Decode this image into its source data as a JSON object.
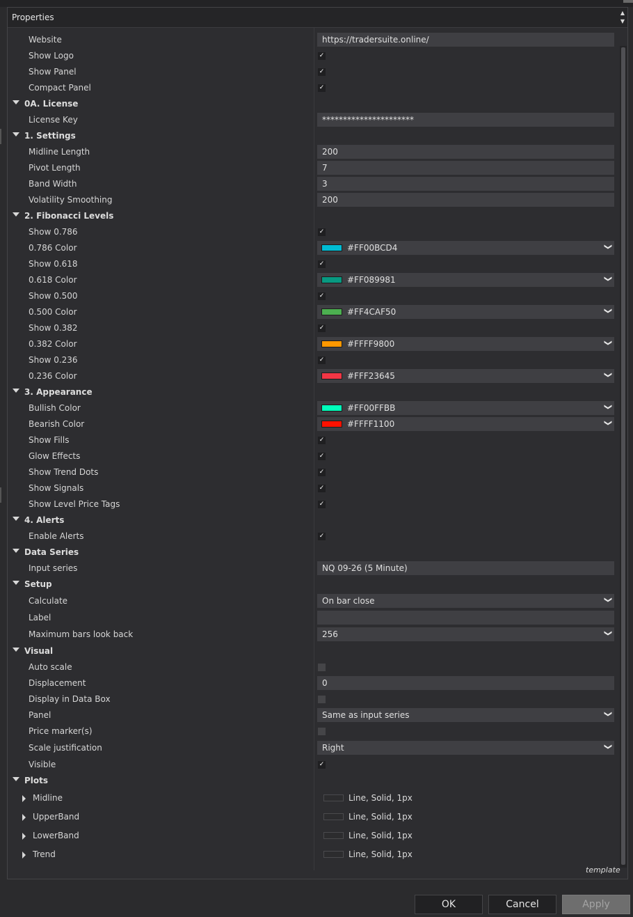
{
  "header": {
    "title": "Properties"
  },
  "rows": [
    {
      "type": "prop",
      "label": "Website",
      "value": "https://tradersuite.online/",
      "kind": "text"
    },
    {
      "type": "prop",
      "label": "Show Logo",
      "kind": "check",
      "checked": true
    },
    {
      "type": "prop",
      "label": "Show Panel",
      "kind": "check",
      "checked": true
    },
    {
      "type": "prop",
      "label": "Compact Panel",
      "kind": "check",
      "checked": true
    },
    {
      "type": "cat",
      "label": "0A. License"
    },
    {
      "type": "prop",
      "label": "License Key",
      "value": "**********************",
      "kind": "text"
    },
    {
      "type": "cat",
      "label": "1. Settings"
    },
    {
      "type": "prop",
      "label": "Midline Length",
      "value": "200",
      "kind": "text"
    },
    {
      "type": "prop",
      "label": "Pivot Length",
      "value": "7",
      "kind": "text"
    },
    {
      "type": "prop",
      "label": "Band Width",
      "value": "3",
      "kind": "text"
    },
    {
      "type": "prop",
      "label": "Volatility Smoothing",
      "value": "200",
      "kind": "text"
    },
    {
      "type": "cat",
      "label": "2. Fibonacci Levels"
    },
    {
      "type": "prop",
      "label": "Show 0.786",
      "kind": "check",
      "checked": true
    },
    {
      "type": "prop",
      "label": "0.786 Color",
      "kind": "color",
      "value": "#FF00BCD4",
      "color": "#00BCD4"
    },
    {
      "type": "prop",
      "label": "Show 0.618",
      "kind": "check",
      "checked": true
    },
    {
      "type": "prop",
      "label": "0.618 Color",
      "kind": "color",
      "value": "#FF089981",
      "color": "#089981"
    },
    {
      "type": "prop",
      "label": "Show 0.500",
      "kind": "check",
      "checked": true
    },
    {
      "type": "prop",
      "label": "0.500 Color",
      "kind": "color",
      "value": "#FF4CAF50",
      "color": "#4CAF50"
    },
    {
      "type": "prop",
      "label": "Show 0.382",
      "kind": "check",
      "checked": true
    },
    {
      "type": "prop",
      "label": "0.382 Color",
      "kind": "color",
      "value": "#FFFF9800",
      "color": "#FF9800"
    },
    {
      "type": "prop",
      "label": "Show 0.236",
      "kind": "check",
      "checked": true
    },
    {
      "type": "prop",
      "label": "0.236 Color",
      "kind": "color",
      "value": "#FFF23645",
      "color": "#F23645"
    },
    {
      "type": "cat",
      "label": "3. Appearance"
    },
    {
      "type": "prop",
      "label": "Bullish Color",
      "kind": "color",
      "value": "#FF00FFBB",
      "color": "#00FFBB"
    },
    {
      "type": "prop",
      "label": "Bearish Color",
      "kind": "color",
      "value": "#FFFF1100",
      "color": "#FF1100"
    },
    {
      "type": "prop",
      "label": "Show Fills",
      "kind": "check",
      "checked": true
    },
    {
      "type": "prop",
      "label": "Glow Effects",
      "kind": "check",
      "checked": true
    },
    {
      "type": "prop",
      "label": "Show Trend Dots",
      "kind": "check",
      "checked": true
    },
    {
      "type": "prop",
      "label": "Show Signals",
      "kind": "check",
      "checked": true
    },
    {
      "type": "prop",
      "label": "Show Level Price Tags",
      "kind": "check",
      "checked": true
    },
    {
      "type": "cat",
      "label": "4. Alerts"
    },
    {
      "type": "prop",
      "label": "Enable Alerts",
      "kind": "check",
      "checked": true
    },
    {
      "type": "cat",
      "label": "Data Series"
    },
    {
      "type": "prop",
      "label": "Input series",
      "value": "NQ 09-26 (5 Minute)",
      "kind": "text"
    },
    {
      "type": "cat",
      "label": "Setup"
    },
    {
      "type": "prop",
      "label": "Calculate",
      "value": "On bar close",
      "kind": "dropdown"
    },
    {
      "type": "prop",
      "label": "Label",
      "value": "",
      "kind": "text"
    },
    {
      "type": "prop",
      "label": "Maximum bars look back",
      "value": "256",
      "kind": "dropdown"
    },
    {
      "type": "cat",
      "label": "Visual"
    },
    {
      "type": "prop",
      "label": "Auto scale",
      "kind": "check",
      "checked": false
    },
    {
      "type": "prop",
      "label": "Displacement",
      "value": "0",
      "kind": "text"
    },
    {
      "type": "prop",
      "label": "Display in Data Box",
      "kind": "check",
      "checked": false
    },
    {
      "type": "prop",
      "label": "Panel",
      "value": "Same as input series",
      "kind": "dropdown"
    },
    {
      "type": "prop",
      "label": "Price marker(s)",
      "kind": "check",
      "checked": false
    },
    {
      "type": "prop",
      "label": "Scale justification",
      "value": "Right",
      "kind": "dropdown"
    },
    {
      "type": "prop",
      "label": "Visible",
      "kind": "check",
      "checked": true
    },
    {
      "type": "cat",
      "label": "Plots"
    },
    {
      "type": "plot",
      "label": "Midline",
      "value": "Line, Solid, 1px"
    },
    {
      "type": "plot",
      "label": "UpperBand",
      "value": "Line, Solid, 1px"
    },
    {
      "type": "plot",
      "label": "LowerBand",
      "value": "Line, Solid, 1px"
    },
    {
      "type": "plot",
      "label": "Trend",
      "value": "Line, Solid, 1px"
    }
  ],
  "footer": {
    "template": "template"
  },
  "buttons": {
    "ok": "OK",
    "cancel": "Cancel",
    "apply": "Apply"
  }
}
